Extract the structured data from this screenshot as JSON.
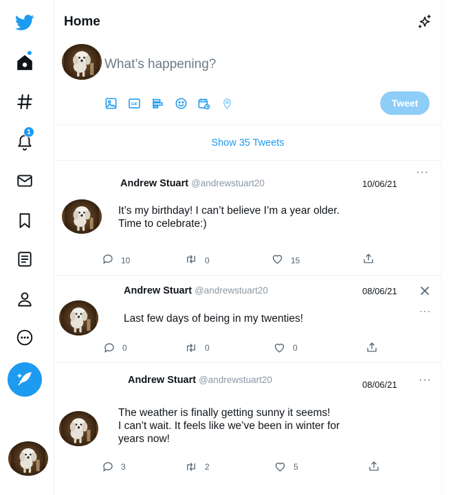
{
  "colors": {
    "accent": "#1d9bf0",
    "tweet_button_disabled": "#8ecdf7",
    "border": "#eff3f4"
  },
  "sidebar": {
    "items": [
      {
        "name": "twitter-logo-icon"
      },
      {
        "name": "home-icon",
        "has_dot": true
      },
      {
        "name": "explore-hashtag-icon"
      },
      {
        "name": "notifications-bell-icon",
        "badge": "1"
      },
      {
        "name": "messages-envelope-icon"
      },
      {
        "name": "bookmarks-icon"
      },
      {
        "name": "lists-icon"
      },
      {
        "name": "profile-icon"
      },
      {
        "name": "more-circle-icon"
      }
    ],
    "compose_icon": "compose-feather-icon"
  },
  "header": {
    "title": "Home",
    "icon": "sparkle-icon"
  },
  "composer": {
    "placeholder": "What’s happening?",
    "tools": [
      "image-icon",
      "gif-icon",
      "poll-icon",
      "emoji-icon",
      "schedule-icon",
      "location-icon"
    ],
    "tweet_label": "Tweet"
  },
  "show_tweets": "Show 35 Tweets",
  "tweets": [
    {
      "name": "Andrew Stuart",
      "handle": "@andrewstuart20",
      "date": "10/06/21",
      "text": "It’s my birthday! I can’t believe I’m a year older.\nTime to celebrate:)",
      "replies": "10",
      "retweets": "0",
      "likes": "15"
    },
    {
      "name": "Andrew Stuart",
      "handle": "@andrewstuart20",
      "date": "08/06/21",
      "text": "Last few days of being in my twenties!",
      "replies": "0",
      "retweets": "0",
      "likes": "0"
    },
    {
      "name": "Andrew Stuart",
      "handle": "@andrewstuart20",
      "date": "08/06/21",
      "text": "The weather is finally getting sunny it seems!\nI can’t wait. It feels like we’ve been in winter for\nyears now!",
      "replies": "3",
      "retweets": "2",
      "likes": "5"
    }
  ]
}
